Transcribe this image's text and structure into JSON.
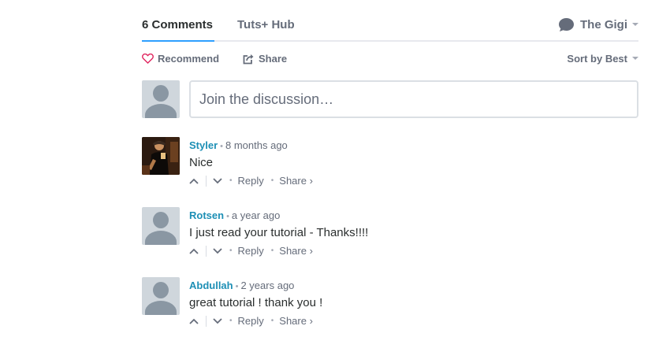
{
  "tabs": {
    "comments": "6 Comments",
    "community": "Tuts+ Hub",
    "user": "The Gigi"
  },
  "actions": {
    "recommend": "Recommend",
    "share": "Share",
    "sort": "Sort by Best"
  },
  "composer": {
    "placeholder": "Join the discussion…"
  },
  "comments": [
    {
      "author": "Styler",
      "time": "8 months ago",
      "message": "Nice",
      "reply": "Reply",
      "share": "Share ›"
    },
    {
      "author": "Rotsen",
      "time": "a year ago",
      "message": "I just read your tutorial - Thanks!!!!",
      "reply": "Reply",
      "share": "Share ›"
    },
    {
      "author": "Abdullah",
      "time": "2 years ago",
      "message": "great tutorial ! thank you !",
      "reply": "Reply",
      "share": "Share ›"
    }
  ],
  "colors": {
    "accent": "#2e9fff",
    "author": "#1d8fb5",
    "muted": "#656c7a",
    "heart": "#e0245e"
  }
}
